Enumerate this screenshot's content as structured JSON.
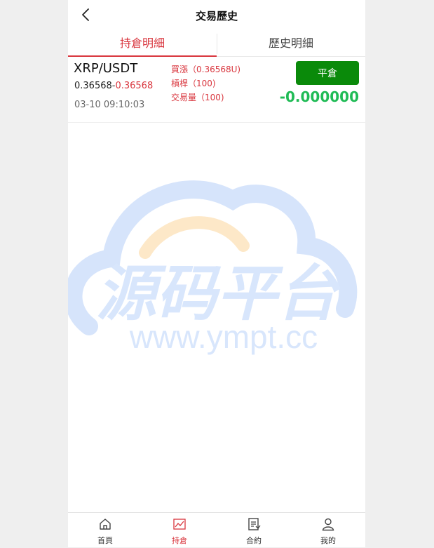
{
  "header": {
    "title": "交易歷史"
  },
  "tabs": [
    {
      "label": "持倉明細"
    },
    {
      "label": "歷史明細"
    }
  ],
  "position": {
    "symbol": "XRP/USDT",
    "open_price": "0.36568",
    "separator": "-",
    "current_price": "0.36568",
    "time": "03-10 09:10:03",
    "direction": "買漲（0.36568U)",
    "leverage": "槓桿（100)",
    "volume": "交易量（100)",
    "close_button": "平倉",
    "pnl": "-0.000000"
  },
  "watermark": {
    "text": "源码平台",
    "url": "www.ympt.cc"
  },
  "bottom_nav": [
    {
      "label": "首頁",
      "icon": "home-icon"
    },
    {
      "label": "持倉",
      "icon": "chart-icon"
    },
    {
      "label": "合約",
      "icon": "contract-icon"
    },
    {
      "label": "我的",
      "icon": "user-icon"
    }
  ],
  "colors": {
    "accent_red": "#d9363e",
    "profit_green": "#1fbb55",
    "close_button_green": "#0a8a0a"
  }
}
